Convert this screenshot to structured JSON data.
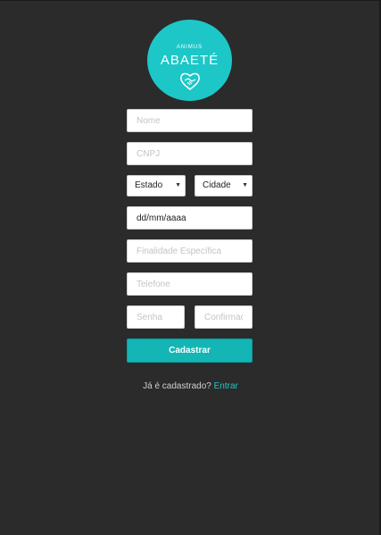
{
  "logo": {
    "top_text": "ANIMUS",
    "name": "ABAETÉ"
  },
  "form": {
    "name_placeholder": "Nome",
    "cnpj_placeholder": "CNPJ",
    "state_select": "Estado",
    "city_select": "Cidade",
    "date_value": "dd/mm/aaaa",
    "purpose_placeholder": "Finalidade Específica",
    "phone_placeholder": "Telefone",
    "password_placeholder": "Senha",
    "confirm_placeholder": "Confirmação",
    "submit_label": "Cadastrar"
  },
  "footer": {
    "question": "Já é cadastrado?",
    "login_link": "Entrar"
  },
  "colors": {
    "accent": "#1dc7c7",
    "background": "#2b2b2b"
  }
}
